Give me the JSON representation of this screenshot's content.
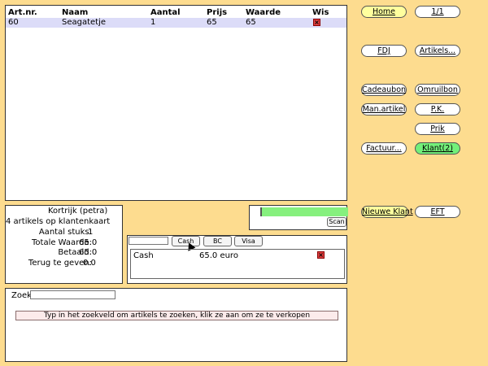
{
  "colors": {
    "background": "#FDDC8F",
    "row_highlight": "#DCDCF8",
    "scan_bar": "#86F07E",
    "button_yellow": "#FFFF9E",
    "button_green": "#73F07A",
    "hint_bg": "#FCEBEB"
  },
  "table": {
    "headers": [
      "Art.nr.",
      "Naam",
      "Aantal",
      "Prijs",
      "Waarde",
      "Wis"
    ],
    "rows": [
      {
        "artnr": "60",
        "naam": "Seagatetje",
        "aantal": "1",
        "prijs": "65",
        "waarde": "65",
        "wis_icon": "delete-icon"
      }
    ]
  },
  "summary": {
    "title": "Kortrijk (petra)",
    "subtitle": "4 artikels op klantenkaart",
    "lines": [
      {
        "label": "Aantal stuks:",
        "value": "1"
      },
      {
        "label": "Totale Waarde:",
        "value": "65.0"
      },
      {
        "label": "Betaald:",
        "value": "65.0"
      },
      {
        "label": "Terug te geven:",
        "value": "0.0"
      }
    ]
  },
  "scan": {
    "button": "Scan"
  },
  "payment": {
    "input_value": "",
    "buttons": [
      "Cash",
      "BC",
      "Visa"
    ],
    "entries": [
      {
        "method": "Cash",
        "amount": "65.0 euro",
        "delete_icon": "delete-icon"
      }
    ]
  },
  "search": {
    "label": "Zoek:",
    "value": "",
    "hint": "Typ in het zoekveld om artikels te zoeken, klik ze aan om ze te verkopen"
  },
  "buttons": {
    "home": "Home",
    "page": "1/1",
    "fdj": "FDJ",
    "artikels": "Artikels...",
    "cadeaubon": "Cadeaubon",
    "omruilbon": "Omruilbon",
    "manartikel": "Man.artikel",
    "pk": "P.K.",
    "prik": "Prik",
    "factuur": "Factuur...",
    "klant": "Klant(2)",
    "nieuwe_klant": "Nieuwe Klant",
    "eft": "EFT"
  }
}
